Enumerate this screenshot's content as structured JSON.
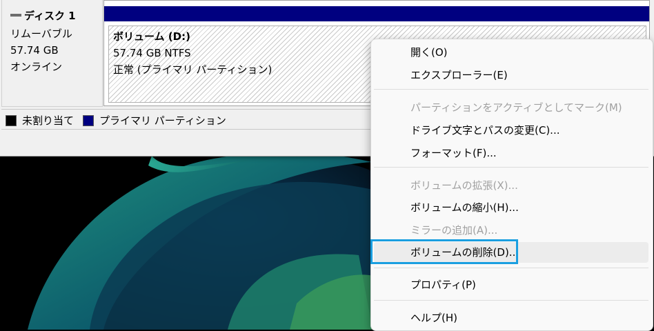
{
  "disk": {
    "title": "ディスク 1",
    "type": "リムーバブル",
    "size": "57.74 GB",
    "status": "オンライン"
  },
  "volume": {
    "name": "ボリューム  (D:)",
    "size_fs": "57.74 GB NTFS",
    "status": "正常 (プライマリ パーティション)",
    "header_color": "#000080"
  },
  "legend": [
    {
      "label": "未割り当て",
      "color": "#000000"
    },
    {
      "label": "プライマリ パーティション",
      "color": "#000080"
    }
  ],
  "context_menu": {
    "open": "開く(O)",
    "explorer": "エクスプローラー(E)",
    "mark_active": "パーティションをアクティブとしてマーク(M)",
    "change_letter": "ドライブ文字とパスの変更(C)...",
    "format": "フォーマット(F)...",
    "extend": "ボリュームの拡張(X)...",
    "shrink": "ボリュームの縮小(H)...",
    "add_mirror": "ミラーの追加(A)...",
    "delete": "ボリュームの削除(D)...",
    "properties": "プロパティ(P)",
    "help": "ヘルプ(H)"
  },
  "colors": {
    "focus_highlight": "#1a9fe0",
    "disabled_text": "#a0a0a0"
  }
}
